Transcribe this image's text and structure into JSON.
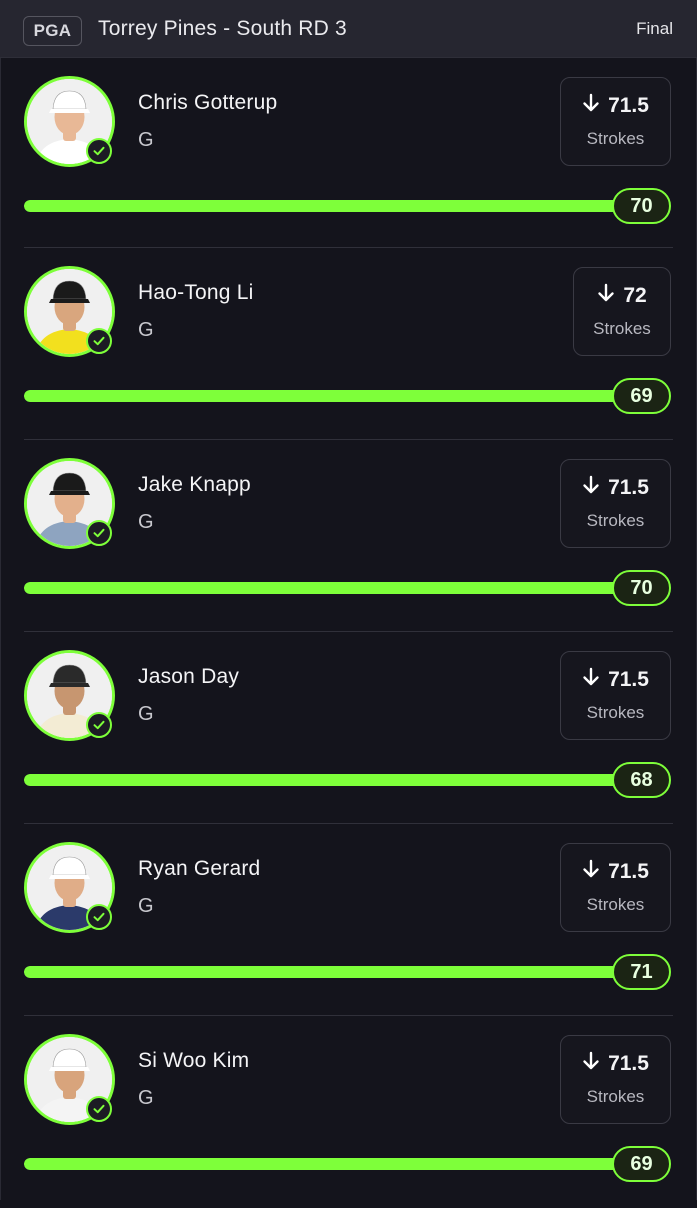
{
  "header": {
    "league": "PGA",
    "event": "Torrey Pines - South RD 3",
    "status": "Final"
  },
  "colors": {
    "accent": "#7eff3a",
    "background": "#14141c",
    "header": "#262630"
  },
  "players": [
    {
      "name": "Chris Gotterup",
      "position": "G",
      "direction_icon": "arrow-down-icon",
      "line": "71.5",
      "line_label": "Strokes",
      "score": "70",
      "progress_percent": 100,
      "shirt": "#ffffff",
      "cap": "#ffffff",
      "skin": "#e8b896"
    },
    {
      "name": "Hao-Tong Li",
      "position": "G",
      "direction_icon": "arrow-down-icon",
      "line": "72",
      "line_label": "Strokes",
      "score": "69",
      "progress_percent": 100,
      "shirt": "#f2e01e",
      "cap": "#1a1a1a",
      "skin": "#d9a67e"
    },
    {
      "name": "Jake Knapp",
      "position": "G",
      "direction_icon": "arrow-down-icon",
      "line": "71.5",
      "line_label": "Strokes",
      "score": "70",
      "progress_percent": 100,
      "shirt": "#8ea4c0",
      "cap": "#1a1a1a",
      "skin": "#e3b08c"
    },
    {
      "name": "Jason Day",
      "position": "G",
      "direction_icon": "arrow-down-icon",
      "line": "71.5",
      "line_label": "Strokes",
      "score": "68",
      "progress_percent": 100,
      "shirt": "#f3ecd4",
      "cap": "#2a2a2a",
      "skin": "#c79670"
    },
    {
      "name": "Ryan Gerard",
      "position": "G",
      "direction_icon": "arrow-down-icon",
      "line": "71.5",
      "line_label": "Strokes",
      "score": "71",
      "progress_percent": 100,
      "shirt": "#2b3a6a",
      "cap": "#ffffff",
      "skin": "#e0ad88"
    },
    {
      "name": "Si Woo Kim",
      "position": "G",
      "direction_icon": "arrow-down-icon",
      "line": "71.5",
      "line_label": "Strokes",
      "score": "69",
      "progress_percent": 100,
      "shirt": "#f4f4f4",
      "cap": "#ffffff",
      "skin": "#d8a47c"
    }
  ]
}
